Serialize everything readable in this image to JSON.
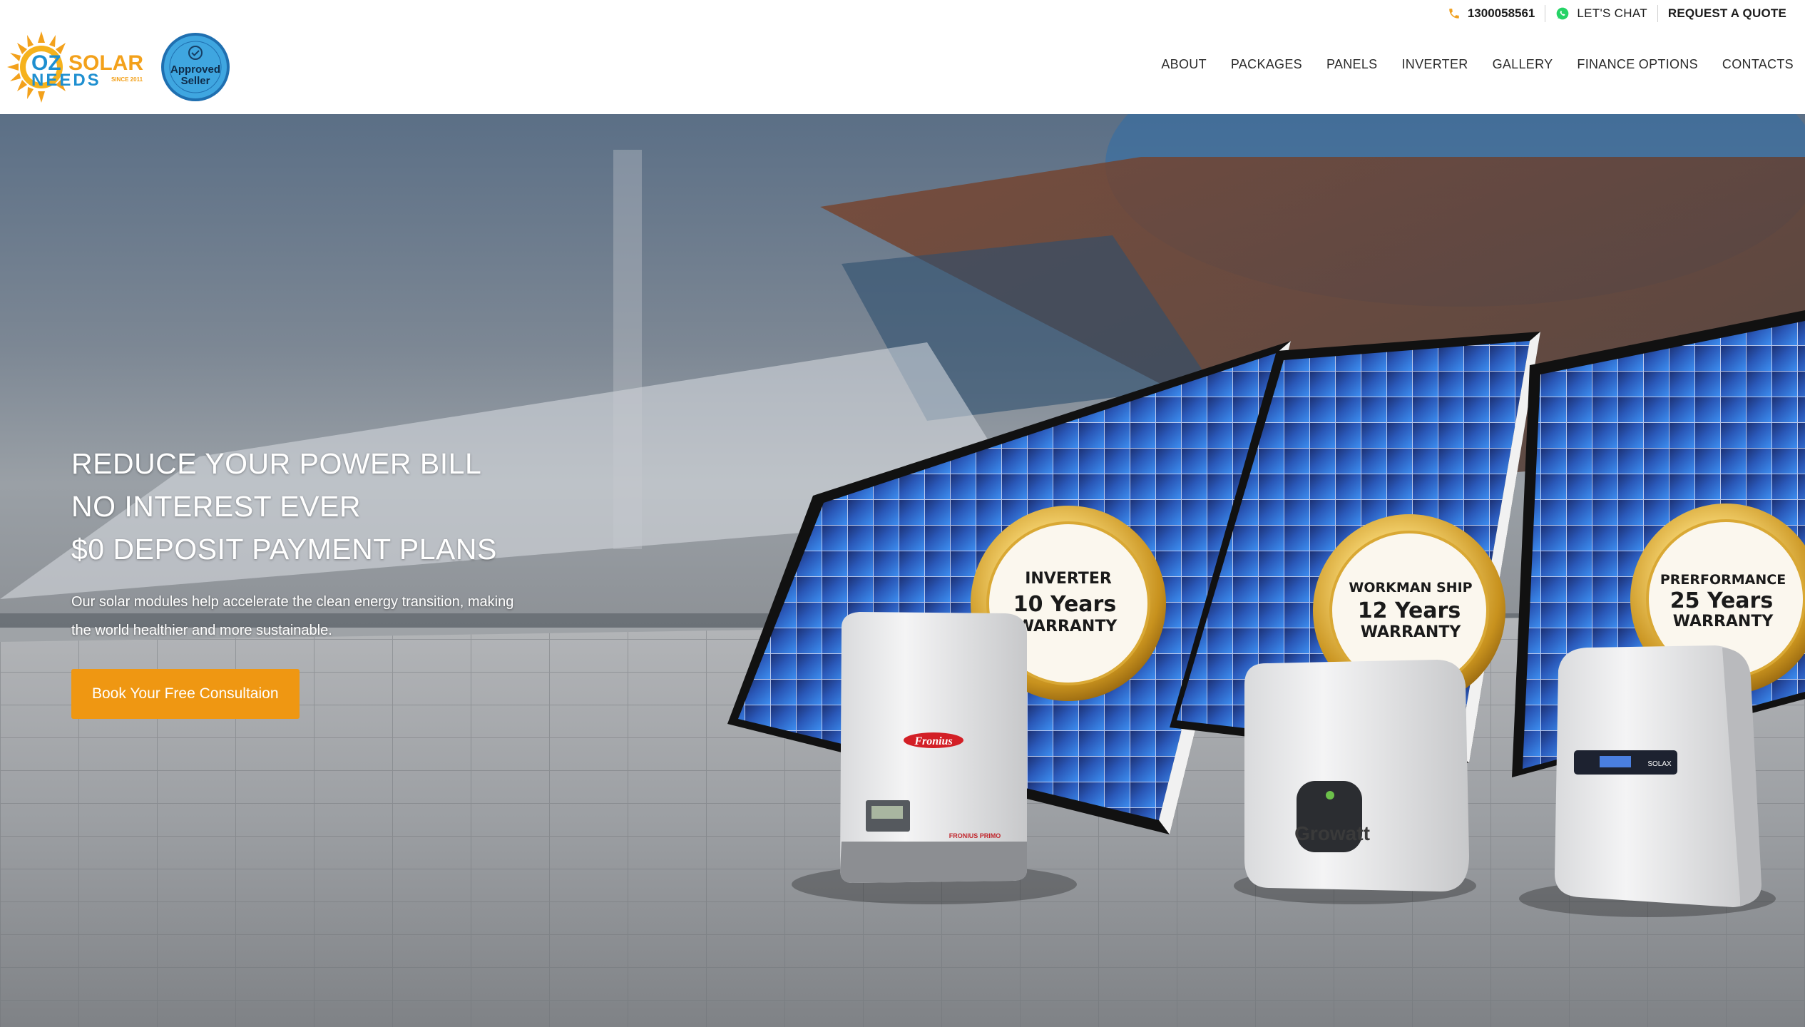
{
  "header": {
    "phone": "1300058561",
    "chat_label": "LET'S CHAT",
    "quote_label": "REQUEST A QUOTE",
    "logo": {
      "line1_a": "OZ",
      "line1_b": "SOLAR",
      "line2": "NEEDS",
      "since": "SINCE 2011"
    },
    "approved_seller": {
      "line1": "Approved",
      "line2": "Seller"
    },
    "nav": [
      "ABOUT",
      "PACKAGES",
      "PANELS",
      "INVERTER",
      "GALLERY",
      "FINANCE OPTIONS",
      "CONTACTS"
    ]
  },
  "hero": {
    "headline": [
      "REDUCE YOUR POWER BILL",
      "NO INTEREST EVER",
      "$0 DEPOSIT PAYMENT PLANS"
    ],
    "subtext": "Our solar modules help accelerate the clean energy transition, making the world healthier and more sustainable.",
    "cta_label": "Book Your Free Consultaion",
    "badges": [
      {
        "top": "INVERTER",
        "mid": "10 Years",
        "bottom": "WARRANTY"
      },
      {
        "top": "WORKMAN SHIP",
        "mid": "12 Years",
        "bottom": "WARRANTY"
      },
      {
        "top": "PRERFORMANCE",
        "mid": "25 Years",
        "bottom": "WARRANTY"
      }
    ],
    "products": [
      {
        "brand": "Fronius",
        "model": "FRONIUS PRIMO"
      },
      {
        "brand": "Growatt"
      },
      {
        "brand": "SOLAX"
      }
    ]
  },
  "colors": {
    "accent": "#ef9712",
    "logo_blue": "#1e8fd0",
    "logo_orange": "#f3a11b",
    "whatsapp": "#25d366"
  },
  "icons": [
    "phone-icon",
    "whatsapp-icon"
  ]
}
